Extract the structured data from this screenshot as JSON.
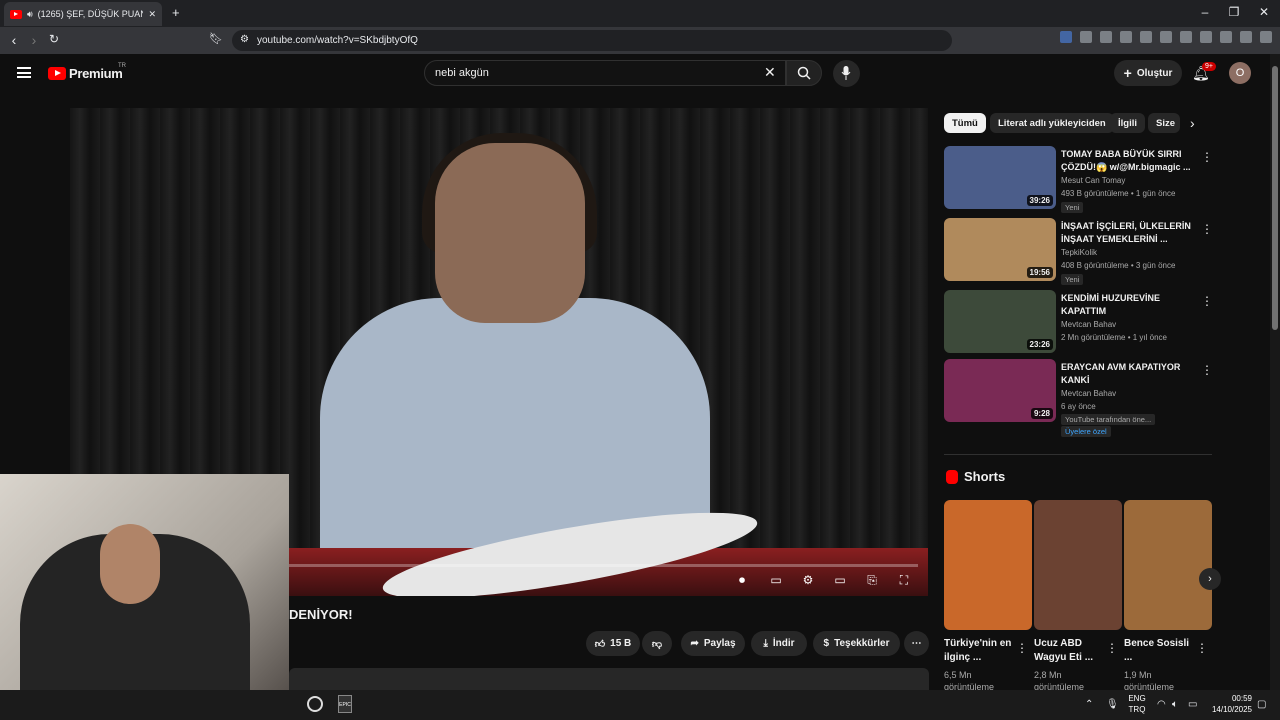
{
  "browser": {
    "tab_title": "(1265) ŞEF, DÜŞÜK PUANLI RE",
    "url": "youtube.com/watch?v=SKbdjbtyOfQ"
  },
  "youtube": {
    "logo_text": "Premium",
    "logo_region": "TR",
    "search_value": "nebi akgün",
    "create_label": "Oluştur",
    "notif_badge": "9+",
    "avatar_letter": "O"
  },
  "video": {
    "title_fragment": "DENİYOR!",
    "like_count": "15 B",
    "share_label": "Paylaş",
    "download_label": "İndir",
    "thanks_label": "Teşekkürler"
  },
  "chips": [
    "Tümü",
    "Literat adlı yükleyiciden",
    "İlgili",
    "Size"
  ],
  "recommendations": [
    {
      "title": "TOMAY BABA BÜYÜK SIRRI ÇÖZDÜ!😱 w/@Mr.bigmagic ...",
      "channel": "Mesut Can Tomay",
      "meta": "493 B görüntüleme • 1 gün önce",
      "tag": "Yeni",
      "duration": "39:26",
      "color": "#4b5d8a"
    },
    {
      "title": "İNŞAAT İŞÇİLERİ, ÜLKELERİN İNŞAAT YEMEKLERİNİ ...",
      "channel": "TepkiKolik",
      "meta": "408 B görüntüleme • 3 gün önce",
      "tag": "Yeni",
      "duration": "19:56",
      "color": "#b08a5c"
    },
    {
      "title": "KENDİMİ HUZUREVİNE KAPATTIM",
      "channel": "Mevtcan Bahav",
      "meta": "2 Mn görüntüleme • 1 yıl önce",
      "tag": "",
      "duration": "23:26",
      "color": "#3d4a3a"
    },
    {
      "title": "ERAYCAN AVM KAPATIYOR KANKİ",
      "channel": "Mevtcan Bahav",
      "meta": "6 ay önce",
      "tag": "YouTube tarafından öne...",
      "tag2": "Üyelere özel",
      "duration": "9:28",
      "color": "#7a2a55"
    }
  ],
  "shorts": {
    "header": "Shorts",
    "items": [
      {
        "title": "Türkiye'nin en ilginç ...",
        "views": "6,5 Mn görüntüleme",
        "color": "#c9682a"
      },
      {
        "title": "Ucuz ABD Wagyu Eti ...",
        "views": "2,8 Mn görüntüleme",
        "color": "#6b4232"
      },
      {
        "title": "Bence Sosisli ...",
        "views": "1,9 Mn görüntüleme",
        "color": "#9c6a3a"
      }
    ]
  },
  "taskbar": {
    "lang_top": "ENG",
    "lang_bottom": "TRQ",
    "time": "00:59",
    "date": "14/10/2025"
  }
}
